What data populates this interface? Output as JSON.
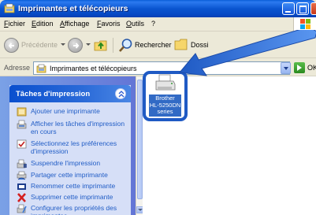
{
  "window": {
    "title": "Imprimantes et télécopieurs"
  },
  "menu": {
    "items": [
      "Fichier",
      "Edition",
      "Affichage",
      "Favoris",
      "Outils",
      "?"
    ]
  },
  "toolbar": {
    "back_label": "Précédente",
    "search_label": "Rechercher",
    "folders_label": "Dossi"
  },
  "address": {
    "label": "Adresse",
    "value": "Imprimantes et télécopieurs",
    "go_label": "OK"
  },
  "task_pane": {
    "title": "Tâches d'impression",
    "tasks": [
      {
        "label": "Ajouter une imprimante",
        "icon": "add-printer-icon"
      },
      {
        "label": "Afficher les tâches d'impression en cours",
        "icon": "print-queue-icon"
      },
      {
        "label": "Sélectionnez les préférences d'impression",
        "icon": "preferences-icon"
      },
      {
        "label": "Suspendre l'impression",
        "icon": "pause-printer-icon"
      },
      {
        "label": "Partager cette imprimante",
        "icon": "share-printer-icon"
      },
      {
        "label": "Renommer cette imprimante",
        "icon": "rename-printer-icon"
      },
      {
        "label": "Supprimer cette imprimante",
        "icon": "delete-x-icon"
      },
      {
        "label": "Configurer les propriétés des imprimantes",
        "icon": "properties-icon"
      }
    ]
  },
  "content": {
    "printer": {
      "label_lines": [
        "Brother",
        "HL-5250DN",
        "series"
      ]
    }
  },
  "colors": {
    "title_bar": "#0a55d0",
    "task_link": "#215dc6",
    "selection": "#316ac5",
    "highlight_border": "#1f5ac4",
    "annotation_arrow": "#1f5ac4"
  }
}
